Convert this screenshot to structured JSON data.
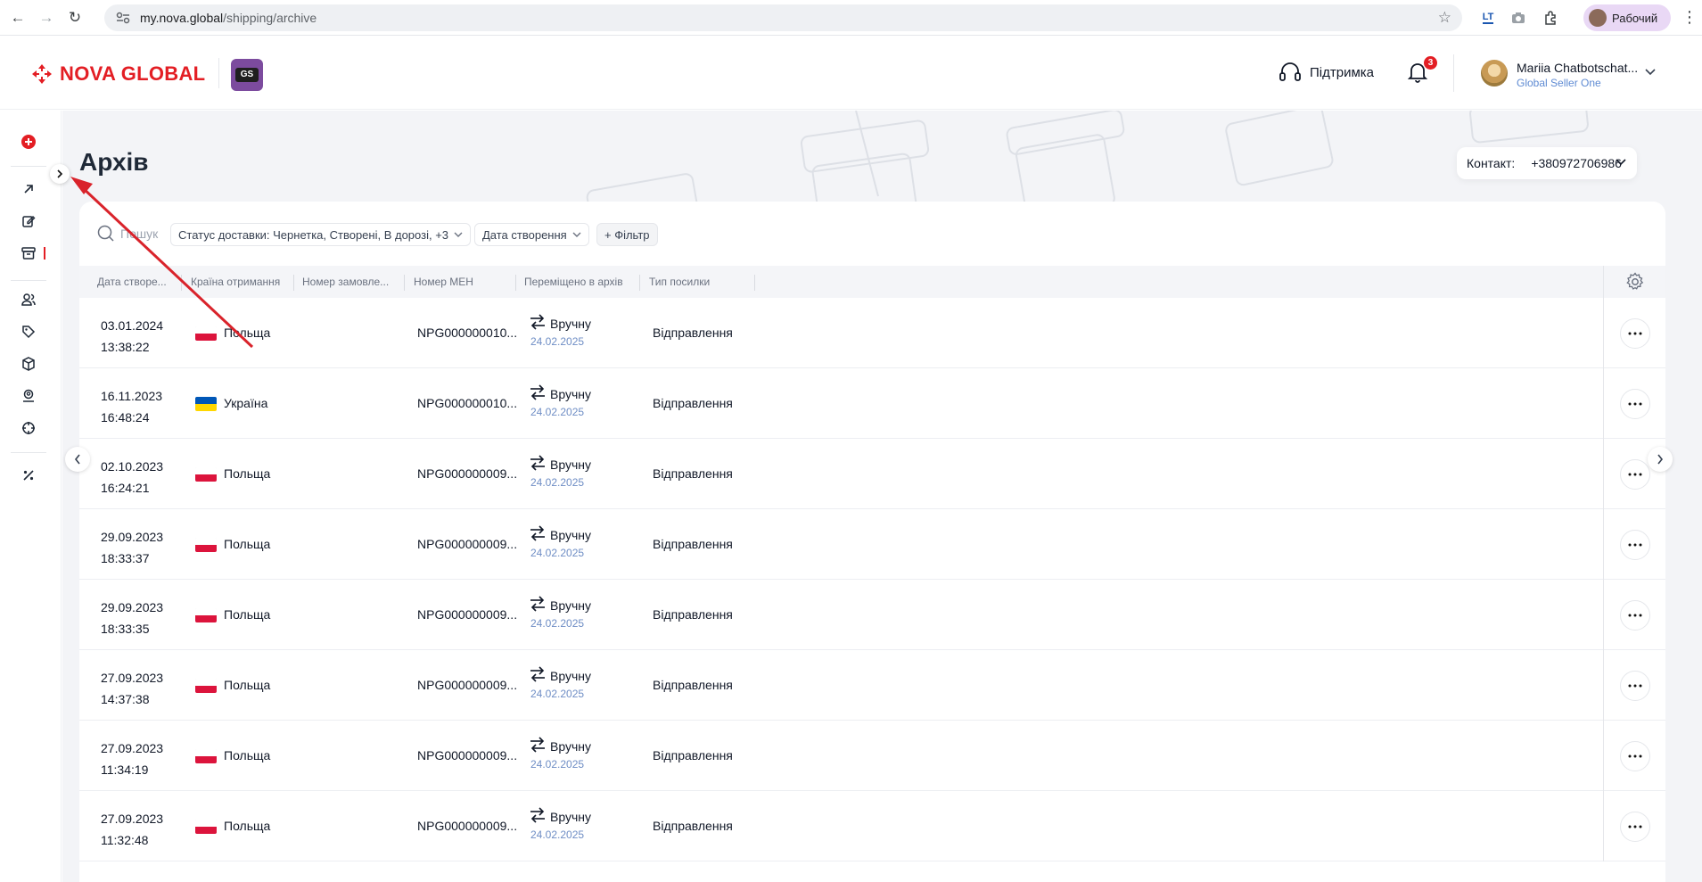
{
  "browser": {
    "url_domain": "my.nova.global",
    "url_path": "/shipping/archive",
    "profile_label": "Рабочий",
    "ext_label": "LT"
  },
  "header": {
    "logo_text": "NOVA GLOBAL",
    "gs_badge": "GS",
    "support_label": "Підтримка",
    "notifications_count": "3",
    "user_name": "Mariia Chatbotschat...",
    "user_company": "Global Seller One"
  },
  "page": {
    "title": "Архів",
    "contact_label": "Контакт:",
    "contact_value": "+380972706986"
  },
  "filters": {
    "search_placeholder": "Пошук",
    "status_chip": "Статус доставки: Чернетка, Створені, В дорозі, +3",
    "date_chip": "Дата створення",
    "add_filter": "+ Фільтр"
  },
  "table": {
    "columns": [
      "Дата створе...",
      "Країна отримання",
      "Номер замовле...",
      "Номер МЕН",
      "Переміщено в архів",
      "Тип посилки"
    ],
    "rows": [
      {
        "date": "03.01.2024",
        "time": "13:38:22",
        "country": "Польща",
        "flag": "pl",
        "men": "NPG000000010...",
        "moved": "Вручну",
        "moved_date": "24.02.2025",
        "type": "Відправлення"
      },
      {
        "date": "16.11.2023",
        "time": "16:48:24",
        "country": "Україна",
        "flag": "ua",
        "men": "NPG000000010...",
        "moved": "Вручну",
        "moved_date": "24.02.2025",
        "type": "Відправлення"
      },
      {
        "date": "02.10.2023",
        "time": "16:24:21",
        "country": "Польща",
        "flag": "pl",
        "men": "NPG000000009...",
        "moved": "Вручну",
        "moved_date": "24.02.2025",
        "type": "Відправлення"
      },
      {
        "date": "29.09.2023",
        "time": "18:33:37",
        "country": "Польща",
        "flag": "pl",
        "men": "NPG000000009...",
        "moved": "Вручну",
        "moved_date": "24.02.2025",
        "type": "Відправлення"
      },
      {
        "date": "29.09.2023",
        "time": "18:33:35",
        "country": "Польща",
        "flag": "pl",
        "men": "NPG000000009...",
        "moved": "Вручну",
        "moved_date": "24.02.2025",
        "type": "Відправлення"
      },
      {
        "date": "27.09.2023",
        "time": "14:37:38",
        "country": "Польща",
        "flag": "pl",
        "men": "NPG000000009...",
        "moved": "Вручну",
        "moved_date": "24.02.2025",
        "type": "Відправлення"
      },
      {
        "date": "27.09.2023",
        "time": "11:34:19",
        "country": "Польща",
        "flag": "pl",
        "men": "NPG000000009...",
        "moved": "Вручну",
        "moved_date": "24.02.2025",
        "type": "Відправлення"
      },
      {
        "date": "27.09.2023",
        "time": "11:32:48",
        "country": "Польща",
        "flag": "pl",
        "men": "NPG000000009...",
        "moved": "Вручну",
        "moved_date": "24.02.2025",
        "type": "Відправлення"
      }
    ]
  },
  "colors": {
    "brand_red": "#e31e24",
    "flag_pl_top": "#ffffff",
    "flag_pl_bottom": "#dc143c",
    "flag_ua_top": "#0057b7",
    "flag_ua_bottom": "#ffd700",
    "moved_date": "#6f8ec5"
  }
}
